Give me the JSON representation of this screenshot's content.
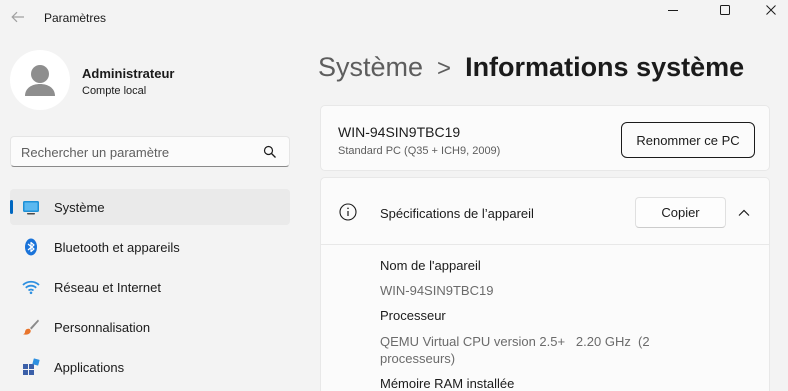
{
  "window": {
    "title": "Paramètres"
  },
  "profile": {
    "name": "Administrateur",
    "account_type": "Compte local"
  },
  "search": {
    "placeholder": "Rechercher un paramètre"
  },
  "sidebar": {
    "items": [
      {
        "label": "Système",
        "icon": "system-icon",
        "active": true
      },
      {
        "label": "Bluetooth et appareils",
        "icon": "bluetooth-icon",
        "active": false
      },
      {
        "label": "Réseau et Internet",
        "icon": "wifi-icon",
        "active": false
      },
      {
        "label": "Personnalisation",
        "icon": "brush-icon",
        "active": false
      },
      {
        "label": "Applications",
        "icon": "apps-icon",
        "active": false
      }
    ]
  },
  "breadcrumb": {
    "parent": "Système",
    "separator": ">",
    "current": "Informations système"
  },
  "pc": {
    "name": "WIN-94SIN9TBC19",
    "model": "Standard PC (Q35 + ICH9, 2009)",
    "rename_label": "Renommer ce PC"
  },
  "specs": {
    "title": "Spécifications de l’appareil",
    "copy_label": "Copier",
    "rows": [
      {
        "label": "Nom de l'appareil",
        "value": "WIN-94SIN9TBC19"
      },
      {
        "label": "Processeur",
        "value_line1": "QEMU Virtual CPU version 2.5+   2.20 GHz  (2",
        "value_line2": "processeurs)"
      },
      {
        "label": "Mémoire RAM installée"
      }
    ]
  },
  "colors": {
    "accent": "#0067c0",
    "background": "#f3f3f3",
    "card": "#fbfbfb"
  }
}
